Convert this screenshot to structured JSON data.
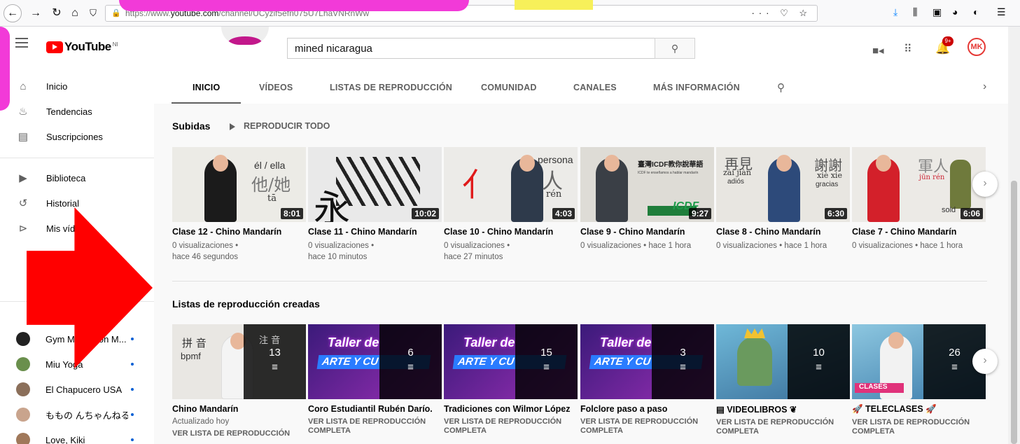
{
  "browser": {
    "url_prefix": "https://www.",
    "url_domain": "youtube.com",
    "url_path": "/channel/UCyzif5efn075U7LhaVNRnWw",
    "url_actions": "··· ♡ ☆"
  },
  "header": {
    "logo_text": "YouTube",
    "logo_region": "NI",
    "search_value": "mined nicaragua",
    "notification_count": "9+",
    "avatar_initials": "MK"
  },
  "sidebar": {
    "items": [
      {
        "label": "Inicio",
        "icon": "home-icon"
      },
      {
        "label": "Tendencias",
        "icon": "trending-icon"
      },
      {
        "label": "Suscripciones",
        "icon": "subscriptions-icon"
      },
      {
        "label": "Biblioteca",
        "icon": "library-icon"
      },
      {
        "label": "Historial",
        "icon": "history-icon"
      },
      {
        "label": "Mis vídeos",
        "icon": "my-videos-icon"
      }
    ],
    "subscriptions": [
      {
        "name": "Gym Motivation M...",
        "color": "#222222"
      },
      {
        "name": "Miu Yoga",
        "color": "#6a8f4c"
      },
      {
        "name": "El Chapucero USA",
        "color": "#8b6f5a"
      },
      {
        "name": "ももの んちゃんねる",
        "color": "#c9a48d"
      },
      {
        "name": "Love, Kiki",
        "color": "#a0785a"
      }
    ]
  },
  "tabs": [
    {
      "label": "INICIO",
      "active": true
    },
    {
      "label": "VÍDEOS"
    },
    {
      "label": "LISTAS DE REPRODUCCIÓN"
    },
    {
      "label": "COMUNIDAD"
    },
    {
      "label": "CANALES"
    },
    {
      "label": "MÁS INFORMACIÓN"
    }
  ],
  "uploads": {
    "title": "Subidas",
    "play_all": "REPRODUCIR TODO",
    "videos": [
      {
        "title": "Clase 12 - Chino Mandarín",
        "duration": "8:01",
        "meta1": "0 visualizaciones •",
        "meta2": "hace 46 segundos",
        "t1": "él / ella",
        "t2": "他/她",
        "t3": "tā"
      },
      {
        "title": "Clase 11 - Chino Mandarín",
        "duration": "10:02",
        "meta1": "0 visualizaciones •",
        "meta2": "hace 10 minutos",
        "t1": "永"
      },
      {
        "title": "Clase 10 - Chino Mandarín",
        "duration": "4:03",
        "meta1": "0 visualizaciones •",
        "meta2": "hace 27 minutos",
        "t1": "persona",
        "t2": "人",
        "t3": "rén",
        "t4": "亻"
      },
      {
        "title": "Clase 9 - Chino Mandarín",
        "duration": "9:27",
        "meta1": "0 visualizaciones • hace 1 hora",
        "meta2": "",
        "t1": "臺灣ICDF教你說華語",
        "t2": "ICDF te enseñamos a hablar mandarín",
        "t3": "ICDF"
      },
      {
        "title": "Clase 8 - Chino Mandarín",
        "duration": "6:30",
        "meta1": "0 visualizaciones • hace 1 hora",
        "meta2": "",
        "t1": "再見",
        "t2": "zài jiàn",
        "t3": "adiós",
        "t4": "謝謝",
        "t5": "xiè xie",
        "t6": "gracias"
      },
      {
        "title": "Clase 7 - Chino Mandarín",
        "duration": "6:06",
        "meta1": "0 visualizaciones • hace 1 hora",
        "meta2": "",
        "t1": "軍人",
        "t2": "jūn rén",
        "t3": "sold"
      }
    ]
  },
  "playlists": {
    "title": "Listas de reproducción creadas",
    "items": [
      {
        "title": "Chino Mandarín",
        "count": "13",
        "updated": "Actualizado hoy",
        "link": "VER LISTA DE REPRODUCCIÓN",
        "link2": "",
        "t1": "拼 音",
        "t2": "bpmf",
        "t3": "注 音"
      },
      {
        "title": "Coro Estudiantil Rubén Darío.",
        "count": "6",
        "updated": "",
        "link": "VER LISTA DE REPRODUCCIÓN",
        "link2": "COMPLETA",
        "t1": "Taller de",
        "t2": "ARTE Y CU"
      },
      {
        "title": "Tradiciones con Wilmor López",
        "count": "15",
        "updated": "",
        "link": "VER LISTA DE REPRODUCCIÓN",
        "link2": "COMPLETA",
        "t1": "Taller de",
        "t2": "ARTE Y CU"
      },
      {
        "title": "Folclore paso a paso",
        "count": "3",
        "updated": "",
        "link": "VER LISTA DE REPRODUCCIÓN",
        "link2": "COMPLETA",
        "t1": "Taller de",
        "t2": "ARTE Y CU"
      },
      {
        "title": "▤ VIDEOLIBROS ❦",
        "count": "10",
        "updated": "",
        "link": "VER LISTA DE REPRODUCCIÓN",
        "link2": "COMPLETA"
      },
      {
        "title": "🚀 TELECLASES 🚀",
        "count": "26",
        "updated": "",
        "link": "VER LISTA DE REPRODUCCIÓN",
        "link2": "COMPLETA",
        "t1": "CLASES"
      }
    ]
  },
  "colors": {
    "youtube_red": "#ff0000",
    "annotation_arrow": "#ff0000",
    "overlay_pink": "#f23ad8",
    "overlay_yellow": "#f7f05a"
  }
}
